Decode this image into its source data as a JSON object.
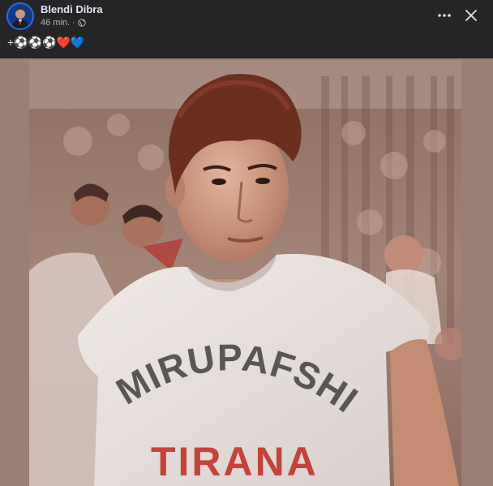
{
  "post": {
    "author": "Blendi Dibra",
    "time": "46 min.",
    "separator": " · ",
    "caption": "+⚽⚽⚽❤️💙"
  },
  "shirt_text": {
    "line1": "MIRUPAFSHIM",
    "line2": "TIRANA"
  },
  "icons": {
    "more": "more-options-icon",
    "close": "close-icon",
    "privacy": "globe-icon"
  },
  "colors": {
    "background": "#242526",
    "text_primary": "#e4e6eb",
    "text_secondary": "#b0b3b8",
    "photo_border": "#9b7f74"
  }
}
